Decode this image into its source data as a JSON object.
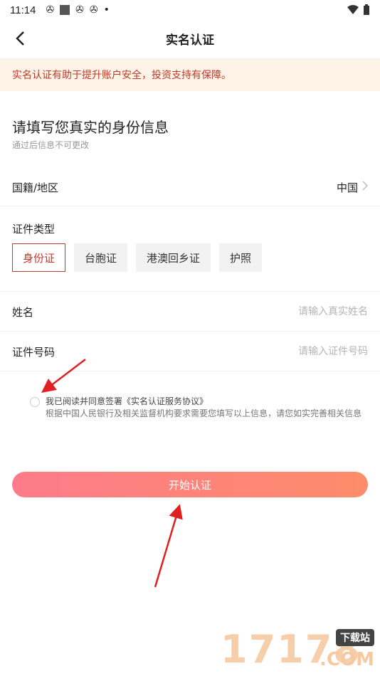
{
  "status_bar": {
    "time": "11:14",
    "dot": "•"
  },
  "nav": {
    "title": "实名认证"
  },
  "notice": {
    "text": "实名认证有助于提升账户安全，投资支持有保障。"
  },
  "intro": {
    "title": "请填写您真实的身份信息",
    "subtitle": "通过后信息不可更改"
  },
  "country": {
    "label": "国籍/地区",
    "value": "中国"
  },
  "doc_type": {
    "label": "证件类型",
    "options": [
      "身份证",
      "台胞证",
      "港澳回乡证",
      "护照"
    ],
    "selected": "身份证"
  },
  "name": {
    "label": "姓名",
    "placeholder": "请输入真实姓名"
  },
  "id_number": {
    "label": "证件号码",
    "placeholder": "请输入证件号码"
  },
  "agreement": {
    "prefix": "我已阅读并同意签署",
    "link": "《实名认证服务协议》",
    "desc": "根据中国人民银行及相关监督机构要求需要您填写以上信息，请您如实完善相关信息"
  },
  "submit_label": "开始认证",
  "watermark": {
    "number": "17178",
    "tag": "下载站",
    "suffix": ".COM"
  },
  "colors": {
    "accent": "#c0392b",
    "notice_bg": "#fdf3e6",
    "button_start": "#fd7b8a",
    "button_end": "#fd8c6a",
    "annotation_arrow": "#e02020"
  }
}
